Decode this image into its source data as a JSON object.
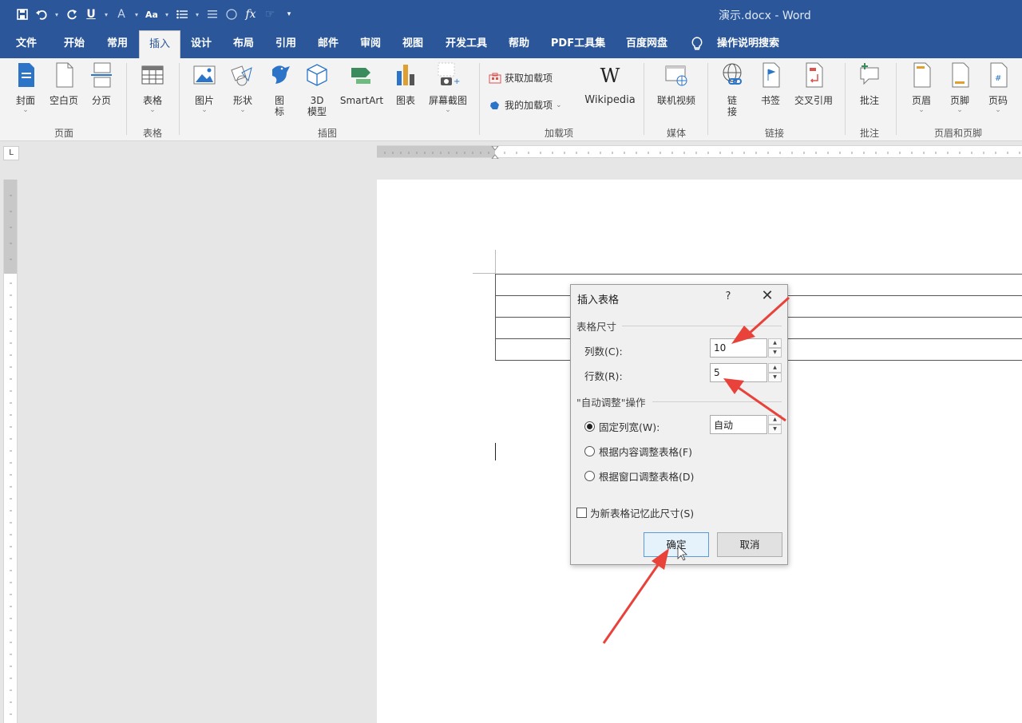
{
  "titlebar": {
    "document_title": "演示.docx  -  Word"
  },
  "tabs": [
    "文件",
    "开始",
    "常用",
    "插入",
    "设计",
    "布局",
    "引用",
    "邮件",
    "审阅",
    "视图",
    "开发工具",
    "帮助",
    "PDF工具集",
    "百度网盘"
  ],
  "tell_me": "操作说明搜索",
  "ribbon": {
    "page_group": {
      "label": "页面",
      "buttons": [
        "封面",
        "空白页",
        "分页"
      ]
    },
    "table_group": {
      "label": "表格",
      "buttons": [
        "表格"
      ]
    },
    "illustrations_group": {
      "label": "插图",
      "buttons": [
        "图片",
        "形状",
        "图\n标",
        "3D\n模型",
        "SmartArt",
        "图表",
        "屏幕截图"
      ]
    },
    "addins_group": {
      "label": "加载项",
      "get_addins": "获取加载项",
      "my_addins": "我的加载项",
      "wikipedia": "Wikipedia"
    },
    "media_group": {
      "label": "媒体",
      "buttons": [
        "联机视频"
      ]
    },
    "links_group": {
      "label": "链接",
      "buttons": [
        "链\n接",
        "书签",
        "交叉引用"
      ]
    },
    "comments_group": {
      "label": "批注",
      "buttons": [
        "批注"
      ]
    },
    "header_footer_group": {
      "label": "页眉和页脚",
      "buttons": [
        "页眉",
        "页脚",
        "页码"
      ]
    }
  },
  "ruler_corner": "L",
  "dialog": {
    "title": "插入表格",
    "help": "?",
    "close": "✕",
    "size_section": "表格尺寸",
    "columns_label": "列数(C):",
    "columns_value": "10",
    "rows_label": "行数(R):",
    "rows_value": "5",
    "autofit_section": "\"自动调整\"操作",
    "fixed_width": "固定列宽(W):",
    "fixed_width_value": "自动",
    "autofit_content": "根据内容调整表格(F)",
    "autofit_window": "根据窗口调整表格(D)",
    "remember": "为新表格记忆此尺寸(S)",
    "ok": "确定",
    "cancel": "取消"
  },
  "colors": {
    "accent": "#2b579a",
    "arrow": "#e8423b"
  }
}
